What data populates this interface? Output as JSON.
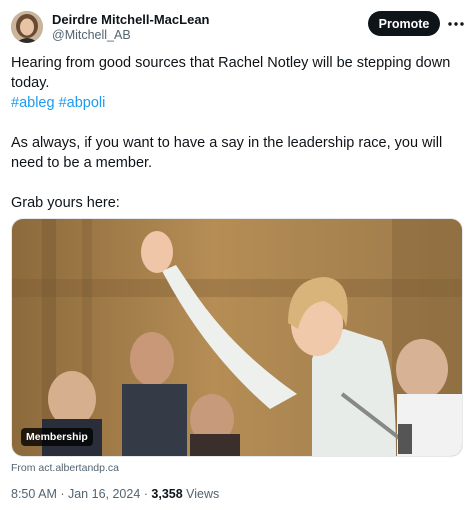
{
  "author": {
    "name": "Deirdre Mitchell-MacLean",
    "handle": "@Mitchell_AB"
  },
  "header": {
    "promote_label": "Promote"
  },
  "tweet": {
    "line1": "Hearing from good sources that Rachel Notley will be stepping down today.",
    "hashtag1": "#ableg",
    "hashtag2": "#abpoli",
    "para2": "As always, if you want to have a say in the leadership race, you will need to be a member.",
    "para3": "Grab yours here:"
  },
  "media": {
    "badge": "Membership",
    "source": "From act.albertandp.ca"
  },
  "meta": {
    "time": "8:50 AM",
    "sep1": " · ",
    "date": "Jan 16, 2024",
    "sep2": " · ",
    "views_count": "3,358",
    "views_label": " Views"
  },
  "colors": {
    "accent": "#1d9bf0",
    "text": "#0f1419",
    "secondary": "#536471"
  },
  "icons": {
    "more": "more-horizontal-icon"
  }
}
